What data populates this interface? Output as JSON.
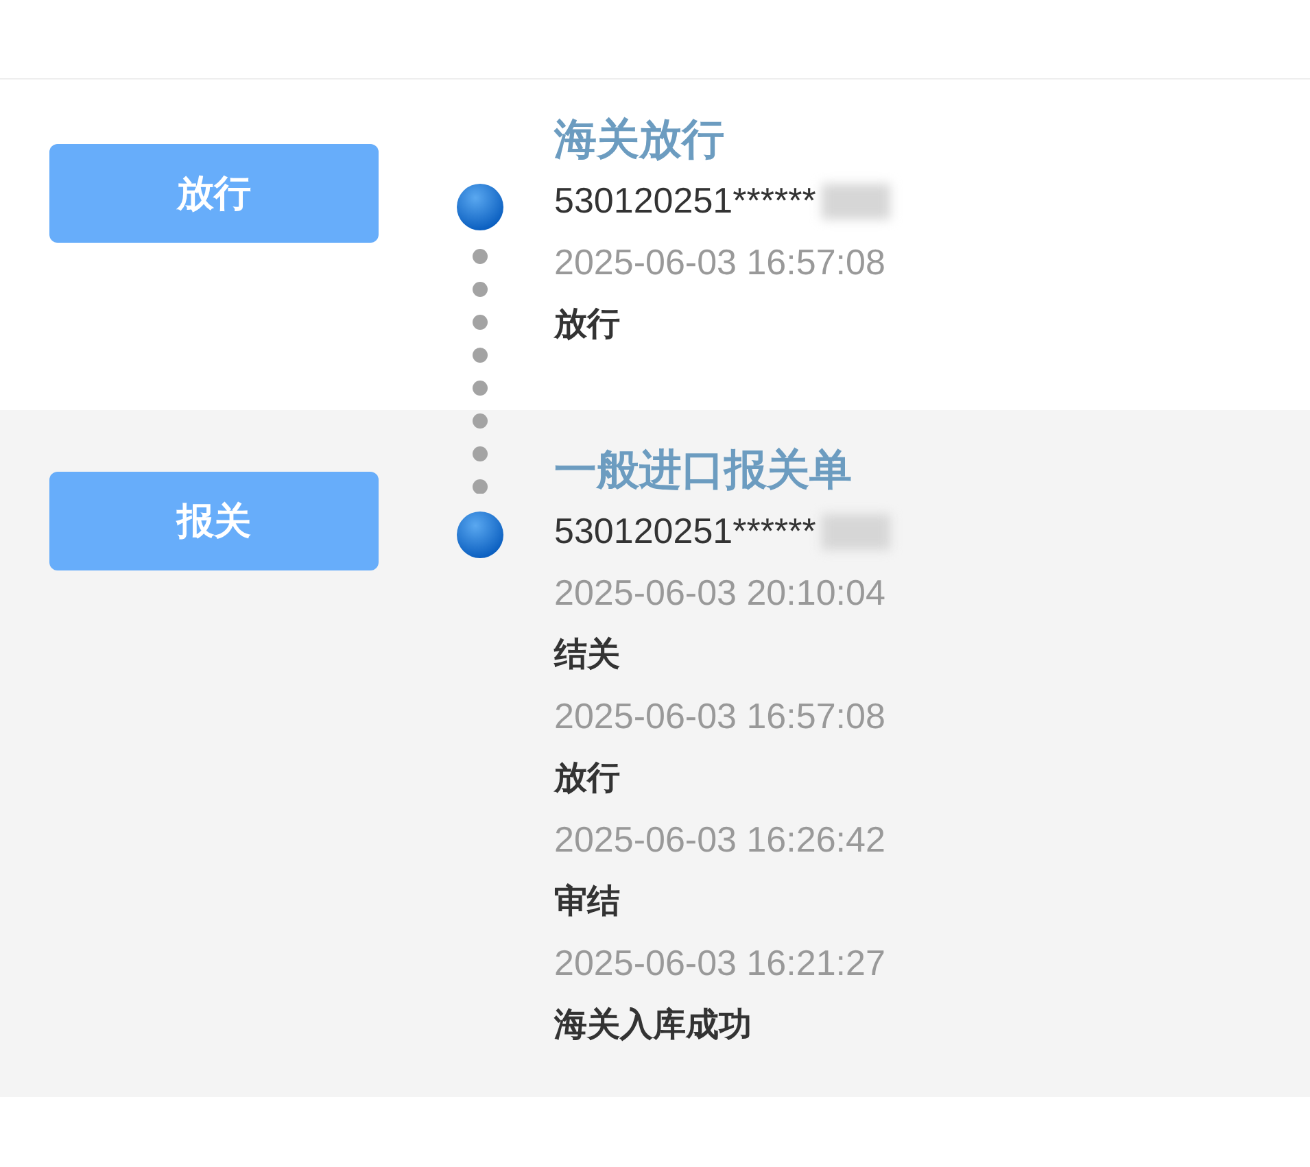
{
  "records": [
    {
      "button": "放行",
      "title": "海关放行",
      "number": "530120251******",
      "events": [
        {
          "time": "2025-06-03 16:57:08",
          "status": "放行"
        }
      ]
    },
    {
      "button": "报关",
      "title": "一般进口报关单",
      "number": "530120251******",
      "events": [
        {
          "time": "2025-06-03 20:10:04",
          "status": "结关"
        },
        {
          "time": "2025-06-03 16:57:08",
          "status": "放行"
        },
        {
          "time": "2025-06-03 16:26:42",
          "status": "审结"
        },
        {
          "time": "2025-06-03 16:21:27",
          "status": "海关入库成功"
        }
      ]
    }
  ]
}
